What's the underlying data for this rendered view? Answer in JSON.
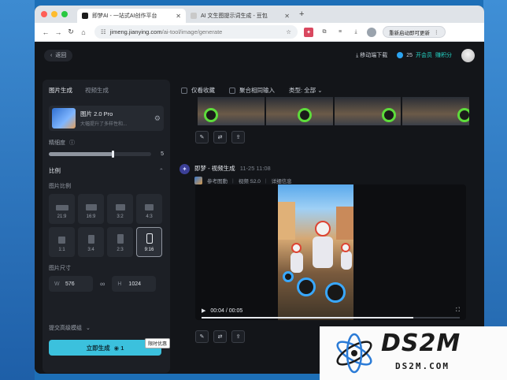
{
  "browser": {
    "tabs": [
      {
        "label": "即梦AI - 一站式AI创作平台",
        "favicon_color": "#1b1b1b"
      },
      {
        "label": "AI 文生图提示词生成 - 豆包",
        "favicon_color": "#e5e5e5"
      }
    ],
    "url_host": "jimeng.jianying.com",
    "url_path": "/ai-tool/image/generate",
    "update_label": "重新启动即可更新",
    "traffic_colors": [
      "#ff5f57",
      "#febc2e",
      "#28c840"
    ]
  },
  "header": {
    "back_label": "返回",
    "download_label": "移动端下载",
    "credits": "25",
    "member_label": "开会员",
    "points_label": "赚积分"
  },
  "sidebar": {
    "tabs": [
      "图片生成",
      "视频生成"
    ],
    "active_tab": 0,
    "model_name": "图片 2.0 Pro",
    "model_desc": "大幅提升了多样性和...",
    "detail_label": "精细度",
    "detail_value": "5",
    "detail_level": 0.62,
    "ratio_section": "比例",
    "ratio_label": "图片比例",
    "ratios": [
      {
        "label": "21:9",
        "selected": false
      },
      {
        "label": "16:9",
        "selected": false
      },
      {
        "label": "3:2",
        "selected": false
      },
      {
        "label": "4:3",
        "selected": false
      },
      {
        "label": "1:1",
        "selected": false
      },
      {
        "label": "3:4",
        "selected": false
      },
      {
        "label": "2:3",
        "selected": false
      },
      {
        "label": "9:16",
        "selected": true
      }
    ],
    "size_label": "图片尺寸",
    "width_key": "W",
    "width_value": "576",
    "height_key": "H",
    "height_value": "1024",
    "advanced_label": "提交高级模组",
    "generate_label": "立即生成",
    "generate_cost": "1",
    "tooltip": "限时优惠"
  },
  "main": {
    "filter_fav": "仅看收藏",
    "filter_merge": "聚合相同输入",
    "filter_type": "类型: 全部",
    "record_title": "即梦 - 视频生成",
    "record_time": "11-25 11:08",
    "meta_ref": "参考图動",
    "meta_model": "视频 S2.0",
    "meta_detail": "详细信息",
    "video_time": "00:04 / 00:05",
    "video_progress": 0.82
  },
  "watermark": {
    "big": "DS2M",
    "small": "DS2M.COM"
  }
}
